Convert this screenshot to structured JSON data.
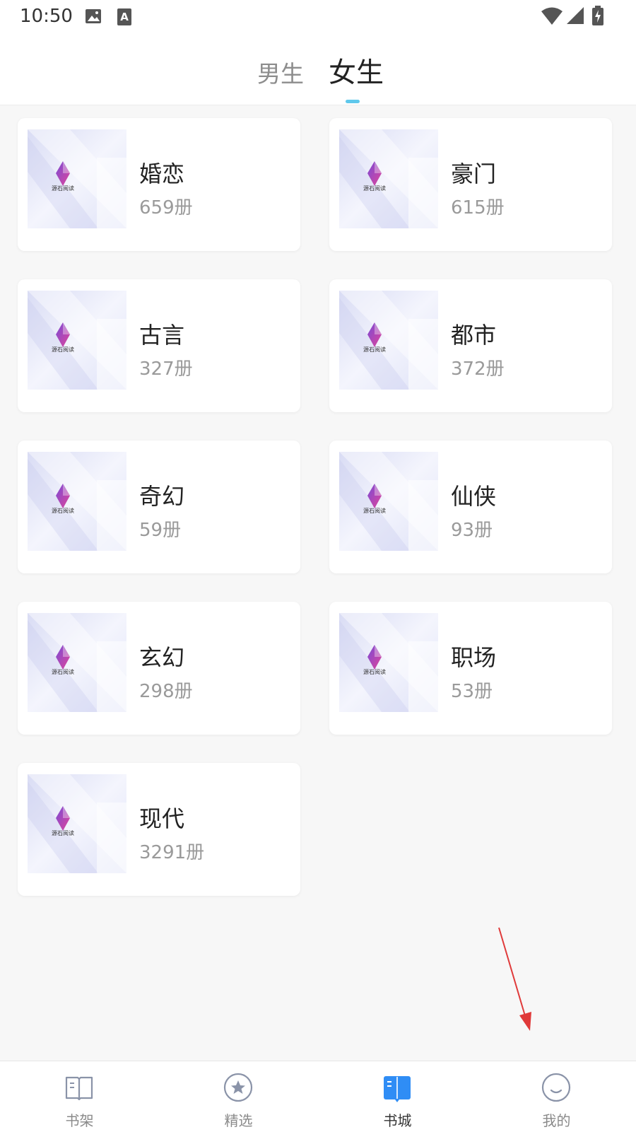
{
  "status_bar": {
    "time": "10:50",
    "icons": [
      "image-icon",
      "font-a-icon",
      "wifi-icon",
      "signal-icon",
      "battery-charging-icon"
    ]
  },
  "top_tabs": [
    {
      "label": "男生",
      "active": false
    },
    {
      "label": "女生",
      "active": true
    }
  ],
  "categories": [
    {
      "name": "婚恋",
      "count": "659册"
    },
    {
      "name": "豪门",
      "count": "615册"
    },
    {
      "name": "古言",
      "count": "327册"
    },
    {
      "name": "都市",
      "count": "372册"
    },
    {
      "name": "奇幻",
      "count": "59册"
    },
    {
      "name": "仙侠",
      "count": "93册"
    },
    {
      "name": "玄幻",
      "count": "298册"
    },
    {
      "name": "职场",
      "count": "53册"
    },
    {
      "name": "现代",
      "count": "3291册"
    }
  ],
  "bottom_nav": [
    {
      "label": "书架",
      "icon": "book-open-icon",
      "active": false
    },
    {
      "label": "精选",
      "icon": "star-circle-icon",
      "active": false
    },
    {
      "label": "书城",
      "icon": "bookstore-icon",
      "active": true
    },
    {
      "label": "我的",
      "icon": "smile-face-icon",
      "active": false
    }
  ],
  "colors": {
    "accent": "#5fc8ec",
    "nav_active_icon": "#2f8df5",
    "annotation": "#e03a3a"
  }
}
